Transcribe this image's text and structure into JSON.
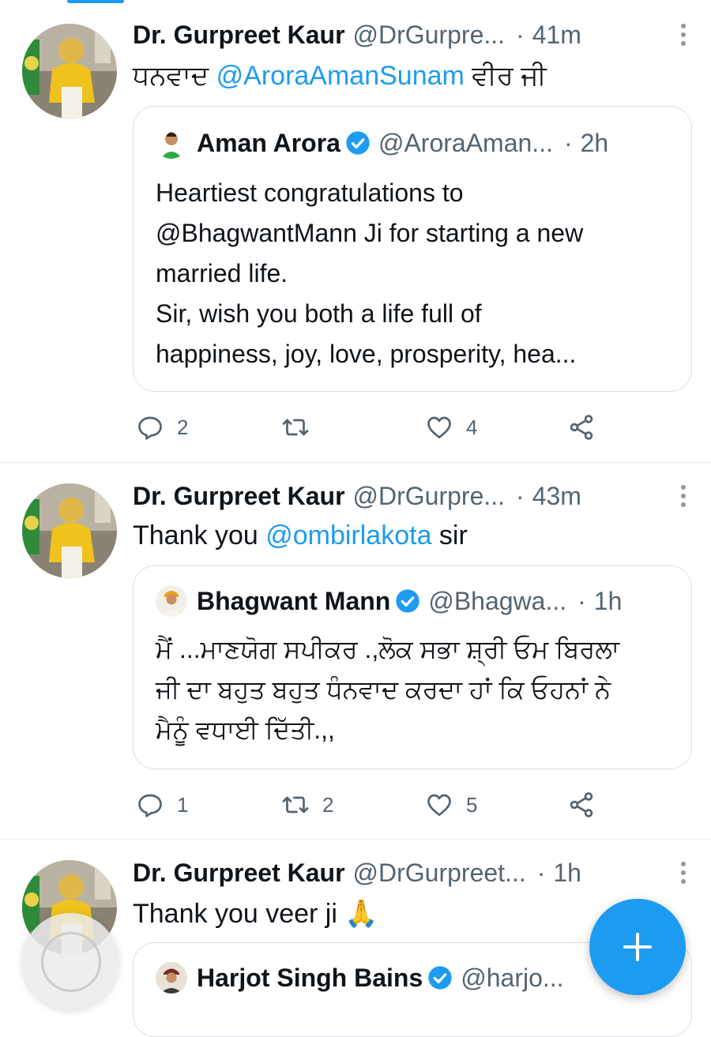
{
  "tweets": [
    {
      "author": "Dr. Gurpreet Kaur",
      "handle": "@DrGurpre...",
      "time": "41m",
      "text_before": "ਧਨਵਾਦ ",
      "mention": "@AroraAmanSunam",
      "text_after": " ਵੀਰ ਜੀ",
      "quote": {
        "author": "Aman Arora",
        "handle": "@AroraAman...",
        "time": "2h",
        "lines": [
          "Heartiest congratulations to",
          "@BhagwantMann Ji for starting a new",
          "married life.",
          "Sir, wish you both a life full of",
          "happiness, joy, love, prosperity, hea..."
        ]
      },
      "actions": {
        "replies": "2",
        "retweets": "",
        "likes": "4"
      }
    },
    {
      "author": "Dr. Gurpreet Kaur",
      "handle": "@DrGurpre...",
      "time": "43m",
      "text_before": "Thank you ",
      "mention": "@ombirlakota",
      "text_after": " sir",
      "quote": {
        "author": "Bhagwant Mann",
        "handle": "@Bhagwa...",
        "time": "1h",
        "lines": [
          "ਮੈਂ ...ਮਾਣਯੋਗ ਸਪੀਕਰ .,ਲੋਕ ਸਭਾ ਸ਼੍ਰੀ ਓਮ ਬਿਰਲਾ",
          "ਜੀ ਦਾ ਬਹੁਤ ਬਹੁਤ ਧੰਨਵਾਦ ਕਰਦਾ ਹਾਂ ਕਿ ਓਹਨਾਂ ਨੇ",
          "ਮੈਨੂੰ ਵਧਾਈ ਦਿੱਤੀ.,,"
        ]
      },
      "actions": {
        "replies": "1",
        "retweets": "2",
        "likes": "5"
      }
    },
    {
      "author": "Dr. Gurpreet Kaur",
      "handle": "@DrGurpreet...",
      "time": "1h",
      "text": "Thank you veer ji 🙏",
      "quote": {
        "author": "Harjot Singh Bains",
        "handle": "@harjo..."
      }
    }
  ],
  "separator": "·",
  "colors": {
    "accent": "#1d9bf0",
    "muted": "#536471",
    "verified": "#1d9bf0"
  },
  "icons": [
    "reply-icon",
    "retweet-icon",
    "like-icon",
    "share-icon",
    "compose-plus-icon",
    "verified-badge-icon",
    "more-options-icon"
  ]
}
